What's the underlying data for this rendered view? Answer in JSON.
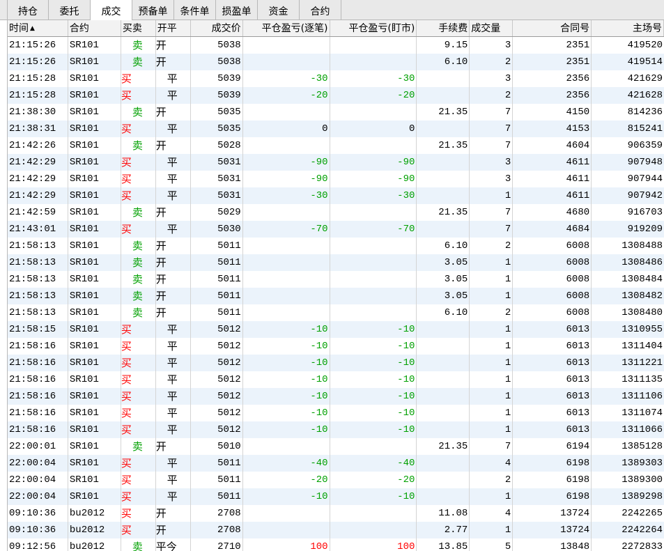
{
  "tabs": [
    {
      "label": "持仓",
      "active": false
    },
    {
      "label": "委托",
      "active": false
    },
    {
      "label": "成交",
      "active": true
    },
    {
      "label": "预备单",
      "active": false
    },
    {
      "label": "条件单",
      "active": false
    },
    {
      "label": "损盈单",
      "active": false
    },
    {
      "label": "资金",
      "active": false
    },
    {
      "label": "合约",
      "active": false
    }
  ],
  "columns": {
    "time": "时间",
    "sort_indicator": "▲",
    "contract": "合约",
    "buy_sell": "买卖",
    "open_close": "开平",
    "price": "成交价",
    "pl_trade": "平仓盈亏(逐笔)",
    "pl_mark": "平仓盈亏(盯市)",
    "fee": "手续费",
    "qty": "成交量",
    "contract_no": "合同号",
    "match_no": "主场号"
  },
  "colors": {
    "buy": "#ff0000",
    "sell": "#00a000",
    "loss": "#00a000",
    "profit": "#ff0000",
    "row_alt": "#ebf3fb"
  },
  "rows": [
    {
      "time": "21:15:26",
      "contract": "SR101",
      "bs": "卖",
      "side": "sell",
      "oc": "开",
      "oc_type": "open",
      "price": "5038",
      "pl1": "",
      "pl2": "",
      "fee": "9.15",
      "qty": "3",
      "cid": "2351",
      "mid": "419520"
    },
    {
      "time": "21:15:26",
      "contract": "SR101",
      "bs": "卖",
      "side": "sell",
      "oc": "开",
      "oc_type": "open",
      "price": "5038",
      "pl1": "",
      "pl2": "",
      "fee": "6.10",
      "qty": "2",
      "cid": "2351",
      "mid": "419514"
    },
    {
      "time": "21:15:28",
      "contract": "SR101",
      "bs": "买",
      "side": "buy",
      "oc": "平",
      "oc_type": "close",
      "price": "5039",
      "pl1": "-30",
      "pl2": "-30",
      "fee": "",
      "qty": "3",
      "cid": "2356",
      "mid": "421629"
    },
    {
      "time": "21:15:28",
      "contract": "SR101",
      "bs": "买",
      "side": "buy",
      "oc": "平",
      "oc_type": "close",
      "price": "5039",
      "pl1": "-20",
      "pl2": "-20",
      "fee": "",
      "qty": "2",
      "cid": "2356",
      "mid": "421628"
    },
    {
      "time": "21:38:30",
      "contract": "SR101",
      "bs": "卖",
      "side": "sell",
      "oc": "开",
      "oc_type": "open",
      "price": "5035",
      "pl1": "",
      "pl2": "",
      "fee": "21.35",
      "qty": "7",
      "cid": "4150",
      "mid": "814236"
    },
    {
      "time": "21:38:31",
      "contract": "SR101",
      "bs": "买",
      "side": "buy",
      "oc": "平",
      "oc_type": "close",
      "price": "5035",
      "pl1": "0",
      "pl2": "0",
      "fee": "",
      "qty": "7",
      "cid": "4153",
      "mid": "815241"
    },
    {
      "time": "21:42:26",
      "contract": "SR101",
      "bs": "卖",
      "side": "sell",
      "oc": "开",
      "oc_type": "open",
      "price": "5028",
      "pl1": "",
      "pl2": "",
      "fee": "21.35",
      "qty": "7",
      "cid": "4604",
      "mid": "906359"
    },
    {
      "time": "21:42:29",
      "contract": "SR101",
      "bs": "买",
      "side": "buy",
      "oc": "平",
      "oc_type": "close",
      "price": "5031",
      "pl1": "-90",
      "pl2": "-90",
      "fee": "",
      "qty": "3",
      "cid": "4611",
      "mid": "907948"
    },
    {
      "time": "21:42:29",
      "contract": "SR101",
      "bs": "买",
      "side": "buy",
      "oc": "平",
      "oc_type": "close",
      "price": "5031",
      "pl1": "-90",
      "pl2": "-90",
      "fee": "",
      "qty": "3",
      "cid": "4611",
      "mid": "907944"
    },
    {
      "time": "21:42:29",
      "contract": "SR101",
      "bs": "买",
      "side": "buy",
      "oc": "平",
      "oc_type": "close",
      "price": "5031",
      "pl1": "-30",
      "pl2": "-30",
      "fee": "",
      "qty": "1",
      "cid": "4611",
      "mid": "907942"
    },
    {
      "time": "21:42:59",
      "contract": "SR101",
      "bs": "卖",
      "side": "sell",
      "oc": "开",
      "oc_type": "open",
      "price": "5029",
      "pl1": "",
      "pl2": "",
      "fee": "21.35",
      "qty": "7",
      "cid": "4680",
      "mid": "916703"
    },
    {
      "time": "21:43:01",
      "contract": "SR101",
      "bs": "买",
      "side": "buy",
      "oc": "平",
      "oc_type": "close",
      "price": "5030",
      "pl1": "-70",
      "pl2": "-70",
      "fee": "",
      "qty": "7",
      "cid": "4684",
      "mid": "919209"
    },
    {
      "time": "21:58:13",
      "contract": "SR101",
      "bs": "卖",
      "side": "sell",
      "oc": "开",
      "oc_type": "open",
      "price": "5011",
      "pl1": "",
      "pl2": "",
      "fee": "6.10",
      "qty": "2",
      "cid": "6008",
      "mid": "1308488"
    },
    {
      "time": "21:58:13",
      "contract": "SR101",
      "bs": "卖",
      "side": "sell",
      "oc": "开",
      "oc_type": "open",
      "price": "5011",
      "pl1": "",
      "pl2": "",
      "fee": "3.05",
      "qty": "1",
      "cid": "6008",
      "mid": "1308486"
    },
    {
      "time": "21:58:13",
      "contract": "SR101",
      "bs": "卖",
      "side": "sell",
      "oc": "开",
      "oc_type": "open",
      "price": "5011",
      "pl1": "",
      "pl2": "",
      "fee": "3.05",
      "qty": "1",
      "cid": "6008",
      "mid": "1308484"
    },
    {
      "time": "21:58:13",
      "contract": "SR101",
      "bs": "卖",
      "side": "sell",
      "oc": "开",
      "oc_type": "open",
      "price": "5011",
      "pl1": "",
      "pl2": "",
      "fee": "3.05",
      "qty": "1",
      "cid": "6008",
      "mid": "1308482"
    },
    {
      "time": "21:58:13",
      "contract": "SR101",
      "bs": "卖",
      "side": "sell",
      "oc": "开",
      "oc_type": "open",
      "price": "5011",
      "pl1": "",
      "pl2": "",
      "fee": "6.10",
      "qty": "2",
      "cid": "6008",
      "mid": "1308480"
    },
    {
      "time": "21:58:15",
      "contract": "SR101",
      "bs": "买",
      "side": "buy",
      "oc": "平",
      "oc_type": "close",
      "price": "5012",
      "pl1": "-10",
      "pl2": "-10",
      "fee": "",
      "qty": "1",
      "cid": "6013",
      "mid": "1310955"
    },
    {
      "time": "21:58:16",
      "contract": "SR101",
      "bs": "买",
      "side": "buy",
      "oc": "平",
      "oc_type": "close",
      "price": "5012",
      "pl1": "-10",
      "pl2": "-10",
      "fee": "",
      "qty": "1",
      "cid": "6013",
      "mid": "1311404"
    },
    {
      "time": "21:58:16",
      "contract": "SR101",
      "bs": "买",
      "side": "buy",
      "oc": "平",
      "oc_type": "close",
      "price": "5012",
      "pl1": "-10",
      "pl2": "-10",
      "fee": "",
      "qty": "1",
      "cid": "6013",
      "mid": "1311221"
    },
    {
      "time": "21:58:16",
      "contract": "SR101",
      "bs": "买",
      "side": "buy",
      "oc": "平",
      "oc_type": "close",
      "price": "5012",
      "pl1": "-10",
      "pl2": "-10",
      "fee": "",
      "qty": "1",
      "cid": "6013",
      "mid": "1311135"
    },
    {
      "time": "21:58:16",
      "contract": "SR101",
      "bs": "买",
      "side": "buy",
      "oc": "平",
      "oc_type": "close",
      "price": "5012",
      "pl1": "-10",
      "pl2": "-10",
      "fee": "",
      "qty": "1",
      "cid": "6013",
      "mid": "1311106"
    },
    {
      "time": "21:58:16",
      "contract": "SR101",
      "bs": "买",
      "side": "buy",
      "oc": "平",
      "oc_type": "close",
      "price": "5012",
      "pl1": "-10",
      "pl2": "-10",
      "fee": "",
      "qty": "1",
      "cid": "6013",
      "mid": "1311074"
    },
    {
      "time": "21:58:16",
      "contract": "SR101",
      "bs": "买",
      "side": "buy",
      "oc": "平",
      "oc_type": "close",
      "price": "5012",
      "pl1": "-10",
      "pl2": "-10",
      "fee": "",
      "qty": "1",
      "cid": "6013",
      "mid": "1311066"
    },
    {
      "time": "22:00:01",
      "contract": "SR101",
      "bs": "卖",
      "side": "sell",
      "oc": "开",
      "oc_type": "open",
      "price": "5010",
      "pl1": "",
      "pl2": "",
      "fee": "21.35",
      "qty": "7",
      "cid": "6194",
      "mid": "1385128"
    },
    {
      "time": "22:00:04",
      "contract": "SR101",
      "bs": "买",
      "side": "buy",
      "oc": "平",
      "oc_type": "close",
      "price": "5011",
      "pl1": "-40",
      "pl2": "-40",
      "fee": "",
      "qty": "4",
      "cid": "6198",
      "mid": "1389303"
    },
    {
      "time": "22:00:04",
      "contract": "SR101",
      "bs": "买",
      "side": "buy",
      "oc": "平",
      "oc_type": "close",
      "price": "5011",
      "pl1": "-20",
      "pl2": "-20",
      "fee": "",
      "qty": "2",
      "cid": "6198",
      "mid": "1389300"
    },
    {
      "time": "22:00:04",
      "contract": "SR101",
      "bs": "买",
      "side": "buy",
      "oc": "平",
      "oc_type": "close",
      "price": "5011",
      "pl1": "-10",
      "pl2": "-10",
      "fee": "",
      "qty": "1",
      "cid": "6198",
      "mid": "1389298"
    },
    {
      "time": "09:10:36",
      "contract": "bu2012",
      "bs": "买",
      "side": "buy",
      "oc": "开",
      "oc_type": "open",
      "price": "2708",
      "pl1": "",
      "pl2": "",
      "fee": "11.08",
      "qty": "4",
      "cid": "13724",
      "mid": "2242265"
    },
    {
      "time": "09:10:36",
      "contract": "bu2012",
      "bs": "买",
      "side": "buy",
      "oc": "开",
      "oc_type": "open",
      "price": "2708",
      "pl1": "",
      "pl2": "",
      "fee": "2.77",
      "qty": "1",
      "cid": "13724",
      "mid": "2242264"
    },
    {
      "time": "09:12:56",
      "contract": "bu2012",
      "bs": "卖",
      "side": "sell",
      "oc": "平今",
      "oc_type": "open",
      "price": "2710",
      "pl1": "100",
      "pl2": "100",
      "fee": "13.85",
      "qty": "5",
      "cid": "13848",
      "mid": "2272833"
    }
  ]
}
